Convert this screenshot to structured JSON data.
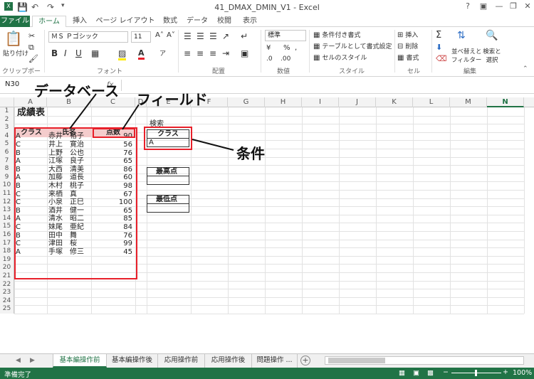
{
  "window": {
    "title": "41_DMAX_DMIN_V1 - Excel",
    "buttons": [
      "?",
      "▣",
      "—",
      "❐",
      "✕"
    ]
  },
  "quick_access": [
    "save",
    "undo",
    "redo"
  ],
  "tabs": [
    "ファイル",
    "ホーム",
    "挿入",
    "ページ レイアウト",
    "数式",
    "データ",
    "校閲",
    "表示"
  ],
  "ribbon": {
    "clipboard": {
      "paste": "貼り付け",
      "label": "クリップボード"
    },
    "font": {
      "name": "ＭＳ Ｐゴシック",
      "size": "11",
      "label": "フォント",
      "bold": "B",
      "italic": "I",
      "underline": "U"
    },
    "alignment": {
      "label": "配置"
    },
    "number": {
      "format": "標準",
      "label": "数値"
    },
    "style": {
      "conditional": "条件付き書式",
      "table": "テーブルとして書式設定",
      "cell": "セルのスタイル",
      "label": "スタイル"
    },
    "cells": {
      "insert": "挿入",
      "delete": "削除",
      "format": "書式",
      "label": "セル"
    },
    "editing": {
      "sort": "並べ替えと",
      "sort2": "フィルター",
      "find": "検索と",
      "find2": "選択",
      "label": "編集"
    }
  },
  "formula_bar": {
    "name_box": "N30",
    "fx": "fx",
    "value": ""
  },
  "columns": [
    "A",
    "B",
    "C",
    "D",
    "E",
    "F",
    "G",
    "H",
    "I",
    "J",
    "K",
    "L",
    "M",
    "N"
  ],
  "rows": [
    "1",
    "2",
    "3",
    "4",
    "5",
    "6",
    "7",
    "8",
    "9",
    "10",
    "11",
    "12",
    "13",
    "14",
    "15",
    "16",
    "17",
    "18",
    "19",
    "20",
    "21",
    "22",
    "23",
    "24",
    "25"
  ],
  "sheet": {
    "title": "成績表",
    "headers": {
      "class": "クラス",
      "name": "氏名",
      "score": "点数"
    },
    "records": [
      {
        "class": "A",
        "name": "赤井　裕子",
        "score": "90"
      },
      {
        "class": "C",
        "name": "井上　寛治",
        "score": "56"
      },
      {
        "class": "B",
        "name": "上野　公也",
        "score": "76"
      },
      {
        "class": "A",
        "name": "江塚　良子",
        "score": "65"
      },
      {
        "class": "B",
        "name": "大西　清美",
        "score": "86"
      },
      {
        "class": "A",
        "name": "加藤　道長",
        "score": "60"
      },
      {
        "class": "B",
        "name": "木村　桃子",
        "score": "98"
      },
      {
        "class": "C",
        "name": "来栖　真",
        "score": "67"
      },
      {
        "class": "C",
        "name": "小泉　正巳",
        "score": "100"
      },
      {
        "class": "B",
        "name": "酒井　健一",
        "score": "65"
      },
      {
        "class": "A",
        "name": "清水　昭二",
        "score": "85"
      },
      {
        "class": "C",
        "name": "妹尾　亜紀",
        "score": "84"
      },
      {
        "class": "B",
        "name": "田中　舞",
        "score": "76"
      },
      {
        "class": "C",
        "name": "津田　桜",
        "score": "99"
      },
      {
        "class": "A",
        "name": "手塚　修三",
        "score": "45"
      }
    ],
    "search_label": "検索",
    "criteria_header": "クラス",
    "criteria_value": "A",
    "max_label": "最高点",
    "min_label": "最低点"
  },
  "annotations": {
    "database": "データベース",
    "field": "フィールド",
    "criteria": "条件"
  },
  "sheet_tabs": [
    "基本編操作前",
    "基本編操作後",
    "応用操作前",
    "応用操作後",
    "問題操作 ..."
  ],
  "status": {
    "ready": "準備完了",
    "zoom": "100%"
  },
  "colors": {
    "excel_green": "#217346",
    "highlight_red": "#e8202a",
    "header_fill": "#f4cccc"
  }
}
